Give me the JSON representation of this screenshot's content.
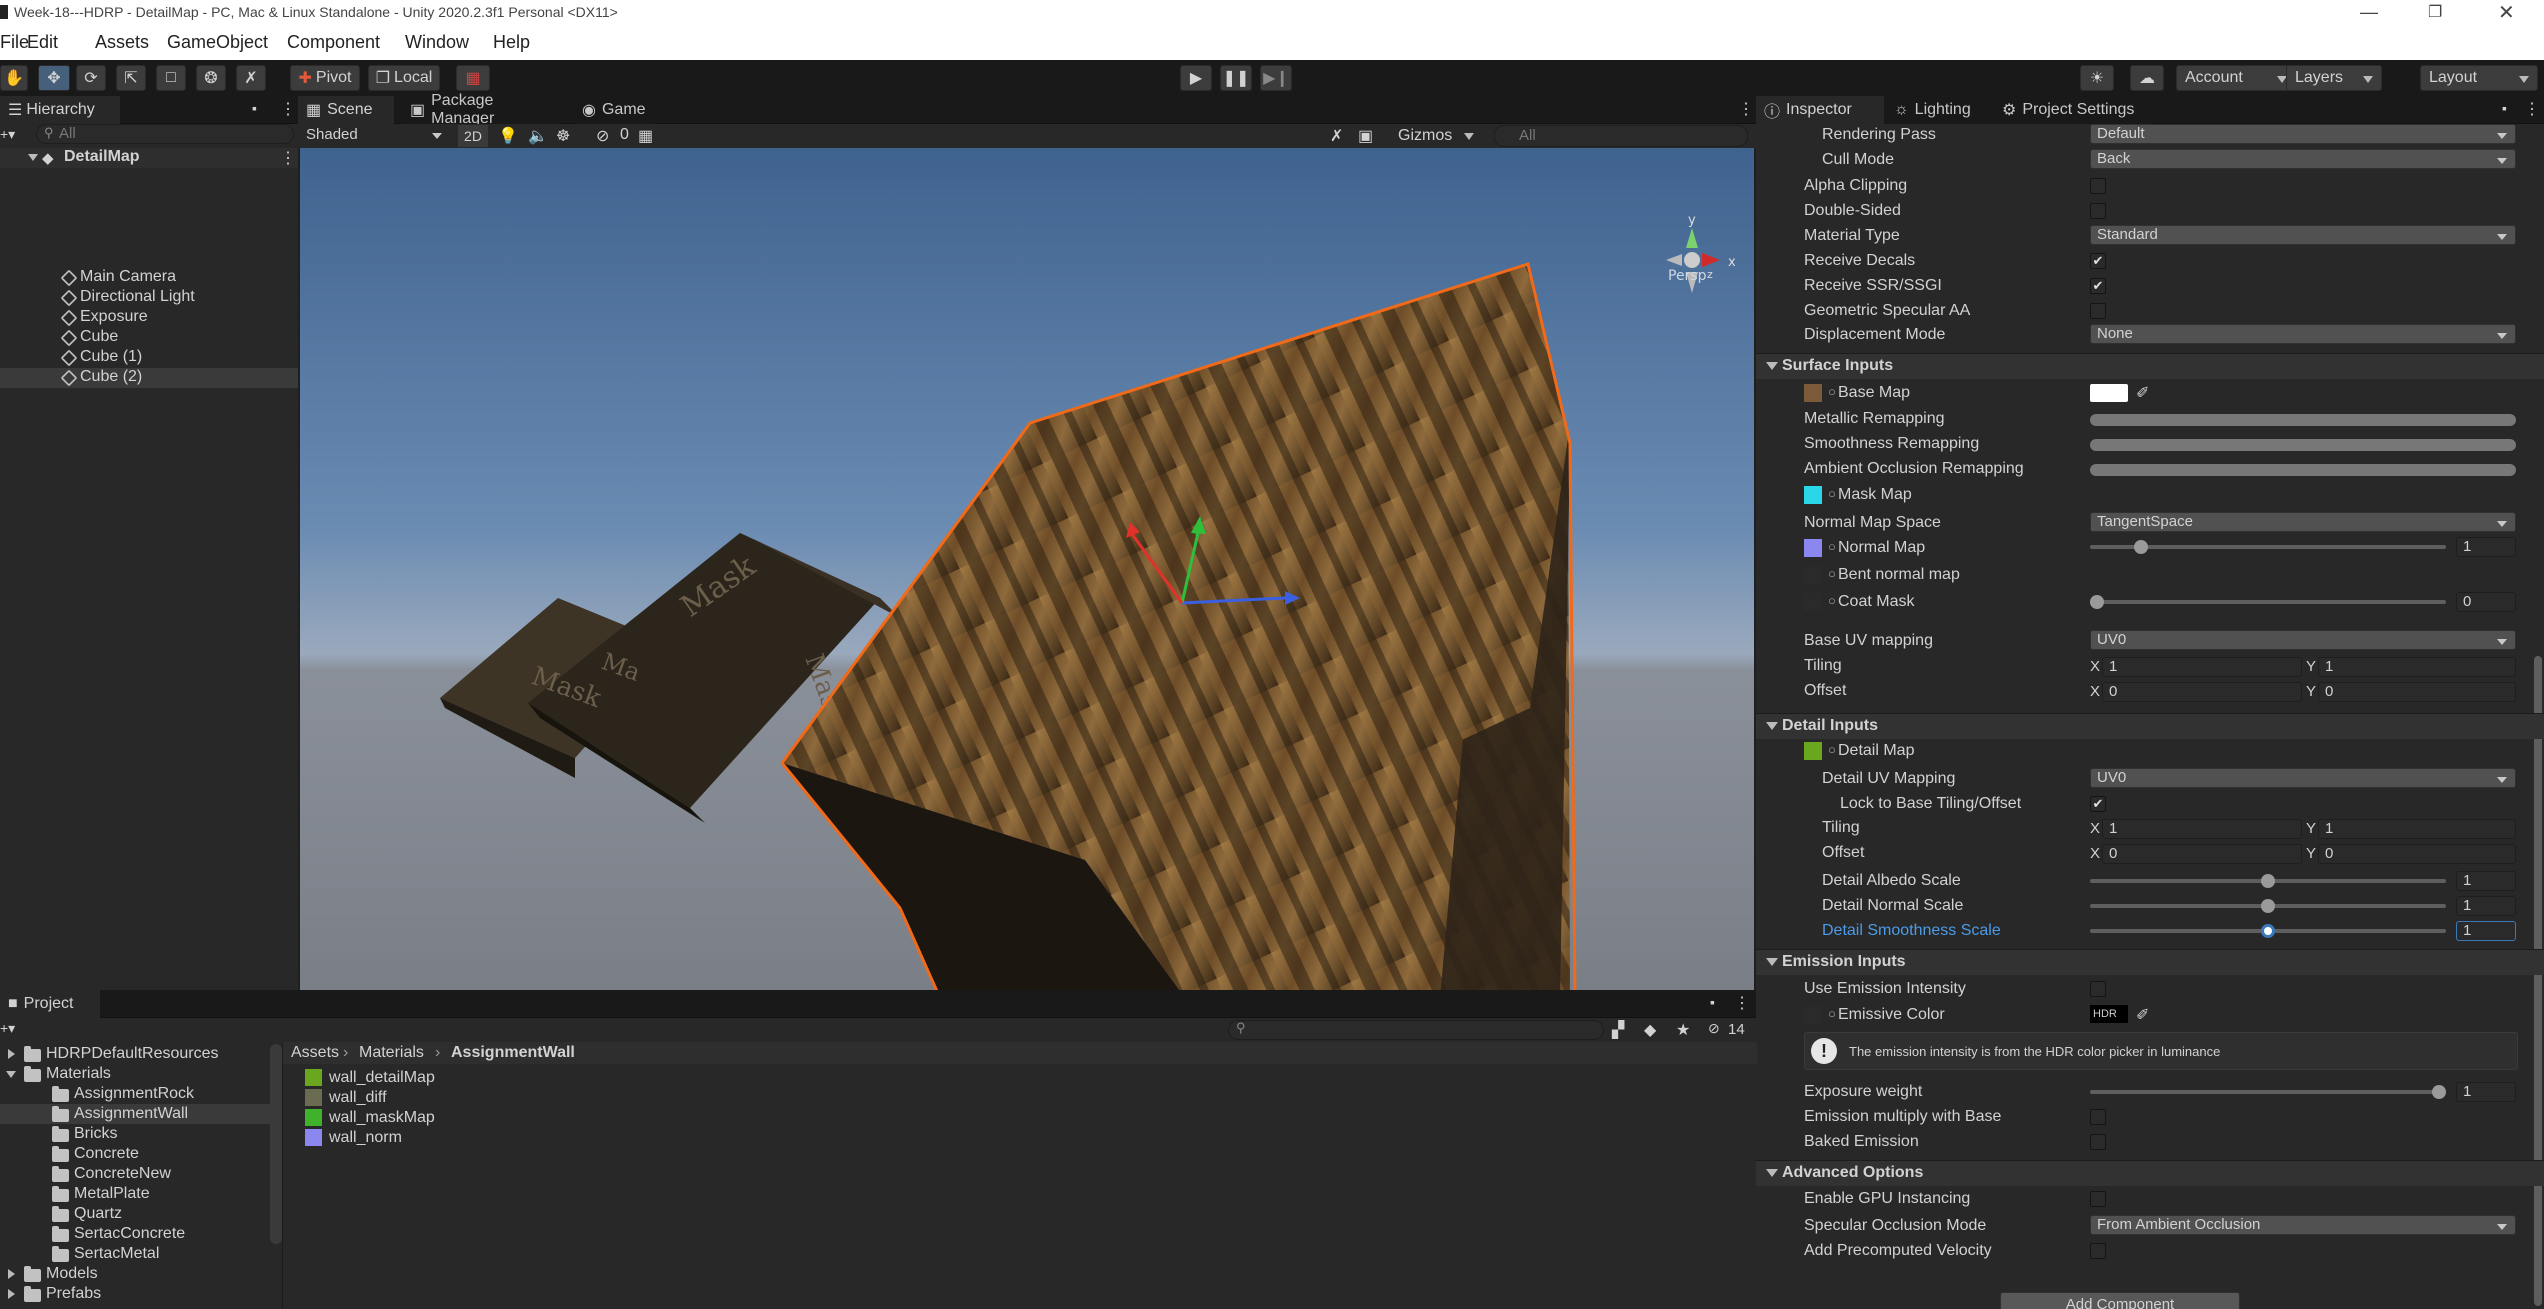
{
  "window": {
    "title": "Week-18---HDRP - DetailMap - PC, Mac & Linux Standalone - Unity 2020.2.3f1 Personal <DX11>"
  },
  "menu": [
    "File",
    "Edit",
    "Assets",
    "GameObject",
    "Component",
    "Window",
    "Help"
  ],
  "toolbar": {
    "pivot": "Pivot",
    "local": "Local",
    "account": "Account",
    "layers": "Layers",
    "layout": "Layout"
  },
  "hierarchy": {
    "tab": "Hierarchy",
    "search_placeholder": "All",
    "scene": "DetailMap",
    "items": [
      "Main Camera",
      "Directional Light",
      "Exposure",
      "Cube",
      "Cube (1)",
      "Cube (2)"
    ],
    "selected": "Cube (2)"
  },
  "scene_tabs": [
    "Scene",
    "Package Manager",
    "Game"
  ],
  "scene_toolbar": {
    "draw_mode": "Shaded",
    "mode_2d": "2D",
    "hidden_count": "0",
    "gizmos": "Gizmos",
    "search_placeholder": "All"
  },
  "scene_view": {
    "persp": "Persp",
    "gizmo_axes": [
      "y",
      "x",
      "z"
    ],
    "box_labels": [
      "Mask",
      "Ma",
      "Mask",
      "Mask"
    ]
  },
  "inspector": {
    "tabs": [
      "Inspector",
      "Lighting",
      "Project Settings"
    ],
    "rows_top": [
      {
        "label": "Rendering Pass",
        "value": "Default"
      },
      {
        "label": "Cull Mode",
        "value": "Back"
      },
      {
        "label": "Alpha Clipping",
        "checked": false
      },
      {
        "label": "Double-Sided",
        "checked": false
      },
      {
        "label": "Material Type",
        "value": "Standard"
      },
      {
        "label": "Receive Decals",
        "checked": true
      },
      {
        "label": "Receive SSR/SSGI",
        "checked": true
      },
      {
        "label": "Geometric Specular AA",
        "checked": false
      },
      {
        "label": "Displacement Mode",
        "value": "None"
      }
    ],
    "surface": {
      "title": "Surface Inputs",
      "base_map": "Base Map",
      "metallic": "Metallic Remapping",
      "smoothness": "Smoothness Remapping",
      "ao": "Ambient Occlusion Remapping",
      "mask_map": "Mask Map",
      "normal_space_label": "Normal Map Space",
      "normal_space": "TangentSpace",
      "normal_map": "Normal Map",
      "normal_value": "1",
      "normal_level": 0.13,
      "bent": "Bent normal map",
      "coat": "Coat Mask",
      "coat_value": "0",
      "coat_level": 0.0,
      "uv_label": "Base UV mapping",
      "uv": "UV0",
      "tiling": "Tiling",
      "offset": "Offset",
      "tiling_x": "1",
      "tiling_y": "1",
      "offset_x": "0",
      "offset_y": "0"
    },
    "detail": {
      "title": "Detail Inputs",
      "map": "Detail Map",
      "uv_label": "Detail UV Mapping",
      "uv": "UV0",
      "lock": "Lock to Base Tiling/Offset",
      "lock_checked": true,
      "tiling": "Tiling",
      "offset": "Offset",
      "tiling_x": "1",
      "tiling_y": "1",
      "offset_x": "0",
      "offset_y": "0",
      "albedo": "Detail Albedo Scale",
      "albedo_value": "1",
      "albedo_level": 0.5,
      "normal": "Detail Normal Scale",
      "normal_value": "1",
      "normal_level": 0.5,
      "smooth": "Detail Smoothness Scale",
      "smooth_value": "1",
      "smooth_level": 0.5
    },
    "emission": {
      "title": "Emission Inputs",
      "intensity": "Use Emission Intensity",
      "color": "Emissive Color",
      "hdr": "HDR",
      "note": "The emission intensity is from the HDR color picker in luminance",
      "exposure": "Exposure weight",
      "exposure_value": "1",
      "exposure_level": 1.0,
      "multiply": "Emission multiply with Base",
      "baked": "Baked Emission"
    },
    "advanced": {
      "title": "Advanced Options",
      "gpu": "Enable GPU Instancing",
      "spec_label": "Specular Occlusion Mode",
      "spec": "From Ambient Occlusion",
      "velocity": "Add Precomputed Velocity"
    },
    "add_component": "Add Component"
  },
  "project": {
    "tab": "Project",
    "count": "14",
    "tree": [
      {
        "name": "HDRPDefaultResources",
        "depth": 1
      },
      {
        "name": "Materials",
        "depth": 1,
        "open": true
      },
      {
        "name": "AssignmentRock",
        "depth": 2
      },
      {
        "name": "AssignmentWall",
        "depth": 2,
        "selected": true
      },
      {
        "name": "Bricks",
        "depth": 2
      },
      {
        "name": "Concrete",
        "depth": 2
      },
      {
        "name": "ConcreteNew",
        "depth": 2
      },
      {
        "name": "MetalPlate",
        "depth": 2
      },
      {
        "name": "Quartz",
        "depth": 2
      },
      {
        "name": "SertacConcrete",
        "depth": 2
      },
      {
        "name": "SertacMetal",
        "depth": 2
      },
      {
        "name": "Models",
        "depth": 1
      },
      {
        "name": "Prefabs",
        "depth": 1
      }
    ],
    "breadcrumb": [
      "Assets",
      "Materials",
      "AssignmentWall"
    ],
    "files": [
      {
        "name": "wall_detailMap",
        "color": "#6aa61e"
      },
      {
        "name": "wall_diff",
        "color": "#6b6b52"
      },
      {
        "name": "wall_maskMap",
        "color": "#3fb12b"
      },
      {
        "name": "wall_norm",
        "color": "#8b86f0"
      }
    ]
  },
  "colors": {
    "accent": "#3a79bb",
    "selection": "#2c5d87",
    "highlight_text": "#4c9be8",
    "outline": "#f06a1a"
  }
}
